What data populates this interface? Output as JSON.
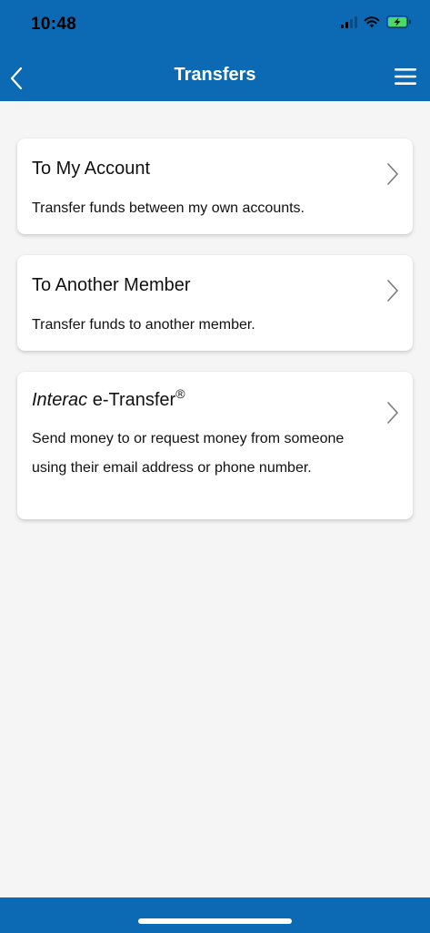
{
  "status_bar": {
    "time": "10:48",
    "icons": [
      "signal-icon",
      "wifi-icon",
      "battery-charging-icon"
    ],
    "battery_color": "#4cd964"
  },
  "nav": {
    "title": "Transfers",
    "back_icon": "chevron-left-icon",
    "menu_icon": "hamburger-menu-icon",
    "bar_color": "#0c6ab5"
  },
  "options": [
    {
      "title": "To My Account",
      "description": "Transfer funds between my own accounts.",
      "icon": "chevron-right-icon"
    },
    {
      "title": "To Another Member",
      "description": "Transfer funds to another member.",
      "icon": "chevron-right-icon"
    },
    {
      "title_italic": "Interac",
      "title_rest": " e-Transfer",
      "title_mark": "®",
      "description": "Send money to or request money from someone using their email address or phone number.",
      "icon": "chevron-right-icon"
    }
  ]
}
